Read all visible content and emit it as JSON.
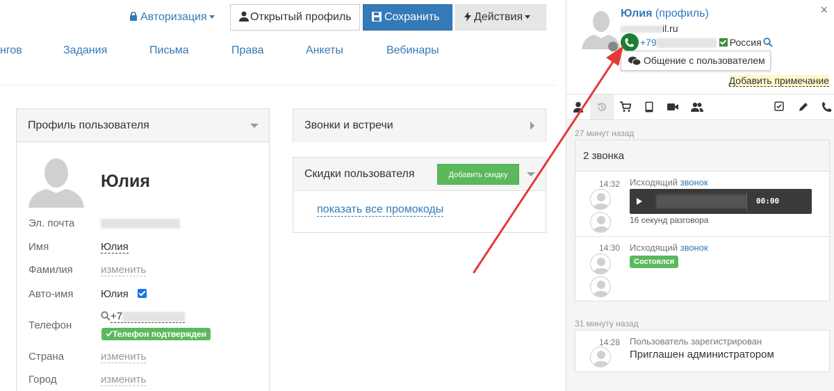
{
  "header": {
    "auth_label": "Авторизация",
    "open_profile_label": "Открытый профиль",
    "save_label": "Сохранить",
    "actions_label": "Действия"
  },
  "nav": {
    "items": [
      "нгов",
      "Задания",
      "Письма",
      "Права",
      "Анкеты",
      "Вебинары"
    ]
  },
  "profile": {
    "title": "Профиль пользователя",
    "name": "Юлия",
    "rows": {
      "email_label": "Эл. почта",
      "first_name_label": "Имя",
      "first_name_value": "Юлия",
      "last_name_label": "Фамилия",
      "last_name_value": "изменить",
      "auto_name_label": "Авто-имя",
      "auto_name_value": "Юлия",
      "phone_label": "Телефон",
      "phone_value": "+7",
      "phone_badge": "Телефон подтвержден",
      "country_label": "Страна",
      "country_value": "изменить",
      "city_label": "Город",
      "city_value": "изменить"
    }
  },
  "calls_panel": {
    "title": "Звонки и встречи"
  },
  "discounts_panel": {
    "title": "Скидки пользователя",
    "add_button": "Добавить скидку",
    "show_promos": "показать все промокоды"
  },
  "sidebar": {
    "close": "×",
    "user_name": "Юлия",
    "user_suffix": " (профиль)",
    "email": "il.ru",
    "phone": "+79",
    "country": "Россия",
    "chat_button": "Общение с пользователем",
    "add_note": "Добавить примечание",
    "tabs": [
      "user-icon",
      "history-icon",
      "cart-icon",
      "tablet-icon",
      "video-icon",
      "users-icon",
      "checkbox-icon",
      "pencil-icon",
      "phone-icon"
    ],
    "groups": [
      {
        "time_ago": "27 минут назад",
        "title": "2 звонка",
        "events": [
          {
            "time": "14:32",
            "prefix": "Исходящий ",
            "link": "звонок",
            "player_time": "00:00",
            "sub": "16 секунд разговора"
          },
          {
            "time": "14:30",
            "prefix": "Исходящий ",
            "link": "звонок",
            "badge": "Состоялся"
          }
        ]
      },
      {
        "time_ago": "31 минуту назад",
        "events": [
          {
            "time": "14:28",
            "title": "Пользователь зарегистрирован",
            "main": "Приглашен администратором"
          }
        ]
      }
    ]
  },
  "colors": {
    "primary": "#337ab7",
    "success": "#5cb85c",
    "arrow": "#e53935"
  }
}
